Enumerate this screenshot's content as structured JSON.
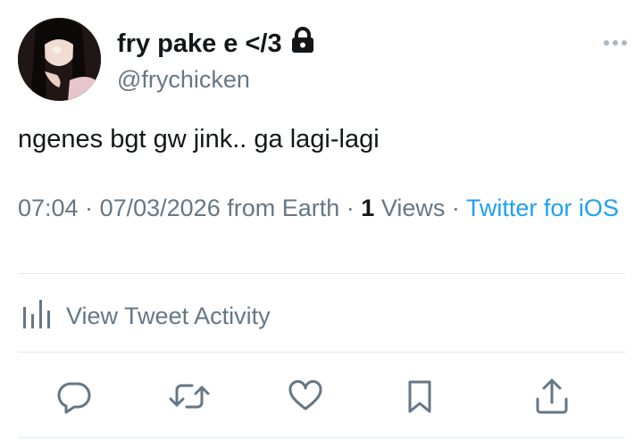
{
  "user": {
    "display_name": "fry pake e </3",
    "handle": "@frychicken",
    "protected_icon": "lock-icon"
  },
  "tweet": {
    "text": "ngenes bgt gw jink.. ga lagi-lagi",
    "time": "07:04",
    "date": "07/03/2026",
    "location": "from Earth",
    "views_count": "1",
    "views_label": "Views",
    "source": "Twitter for iOS"
  },
  "activity": {
    "label": "View Tweet Activity",
    "icon": "bar-chart-icon"
  },
  "actions": [
    {
      "name": "reply",
      "icon": "reply-icon"
    },
    {
      "name": "retweet",
      "icon": "retweet-icon"
    },
    {
      "name": "like",
      "icon": "heart-icon"
    },
    {
      "name": "bookmark",
      "icon": "bookmark-icon"
    },
    {
      "name": "share",
      "icon": "share-icon"
    }
  ],
  "colors": {
    "text": "#14171a",
    "secondary": "#657786",
    "link": "#1da1f2",
    "divider": "#e1e8ed"
  }
}
